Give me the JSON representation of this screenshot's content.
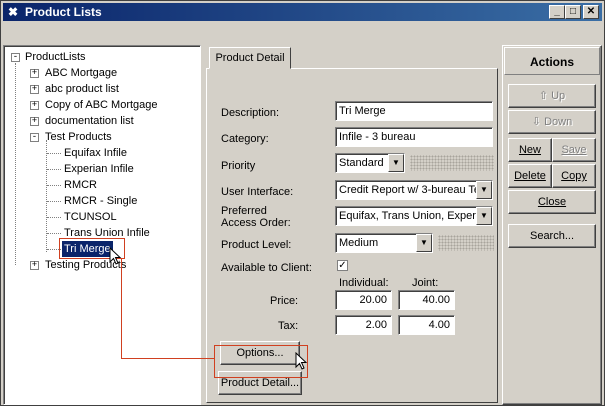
{
  "window": {
    "title": "Product Lists"
  },
  "titlebar_buttons": {
    "minimize": "_",
    "maximize": "□",
    "close": "✕"
  },
  "tree": {
    "root": "ProductLists",
    "items": [
      {
        "label": "ABC Mortgage",
        "expander": "+"
      },
      {
        "label": "abc product list",
        "expander": "+"
      },
      {
        "label": "Copy of ABC Mortgage",
        "expander": "+"
      },
      {
        "label": "documentation list",
        "expander": "+"
      },
      {
        "label": "Test Products",
        "expander": "-"
      },
      {
        "label": "Testing Products",
        "expander": "+"
      }
    ],
    "children": [
      "Equifax Infile",
      "Experian Infile",
      "RMCR",
      "RMCR - Single",
      "TCUNSOL",
      "Trans Union Infile",
      "Tri Merge"
    ]
  },
  "tab": {
    "label": "Product Detail"
  },
  "form": {
    "description_label": "Description:",
    "description_value": "Tri Merge",
    "category_label": "Category:",
    "category_value": "Infile - 3 bureau",
    "priority_label": "Priority",
    "priority_value": "Standard",
    "ui_label": "User Interface:",
    "ui_value": "Credit Report w/ 3-bureau Te",
    "access_label_1": "Preferred",
    "access_label_2": "Access Order:",
    "access_value": "Equifax, Trans Union, Experia",
    "level_label": "Product Level:",
    "level_value": "Medium",
    "available_label": "Available to Client:",
    "available_checked": "✓",
    "individual_label": "Individual:",
    "joint_label": "Joint:",
    "price_label": "Price:",
    "price_individual": "20.00",
    "price_joint": "40.00",
    "tax_label": "Tax:",
    "tax_individual": "2.00",
    "tax_joint": "4.00",
    "options_button": "Options...",
    "product_detail_button": "Product Detail..."
  },
  "actions": {
    "header": "Actions",
    "up": "Up",
    "down": "Down",
    "new": "New",
    "save": "Save",
    "delete": "Delete",
    "copy": "Copy",
    "close": "Close",
    "search": "Search..."
  },
  "colors": {
    "selection": "#0a246a",
    "callout": "#d04020",
    "titlebar": "#0a246a"
  }
}
